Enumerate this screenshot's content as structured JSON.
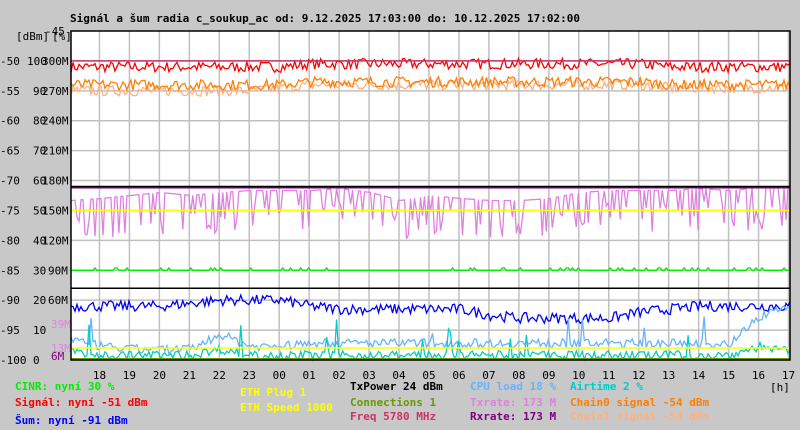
{
  "chart_data": {
    "type": "line",
    "title": "Signál a šum radia c_soukup_ac od: 9.12.2025 17:03:00 do: 10.12.2025 17:02:00",
    "unit_labels": {
      "dbm": "[dBm]",
      "pct": "[%]",
      "hours": "[h]"
    },
    "y_top_label": "-45",
    "ylim_dbm": [
      -100,
      -45
    ],
    "grid": true,
    "y_ticks": [
      {
        "dbm": "-50",
        "pct": "100",
        "rate": "300M",
        "v": -50
      },
      {
        "dbm": "-55",
        "pct": "90",
        "rate": "270M",
        "v": -55
      },
      {
        "dbm": "-60",
        "pct": "80",
        "rate": "240M",
        "v": -60
      },
      {
        "dbm": "-65",
        "pct": "70",
        "rate": "210M",
        "v": -65
      },
      {
        "dbm": "-70",
        "pct": "60",
        "rate": "180M",
        "v": -70
      },
      {
        "dbm": "-75",
        "pct": "50",
        "rate": "150M",
        "v": -75
      },
      {
        "dbm": "-80",
        "pct": "40",
        "rate": "120M",
        "v": -80
      },
      {
        "dbm": "-85",
        "pct": "30",
        "rate": "90M",
        "v": -85
      },
      {
        "dbm": "-90",
        "pct": "20",
        "rate": "60M",
        "v": -90
      },
      {
        "dbm": "-95",
        "pct": "10",
        "rate": "",
        "v": -95
      },
      {
        "dbm": "-100",
        "pct": "0",
        "rate": "",
        "v": -100
      }
    ],
    "extra_rate_labels": [
      {
        "text": "39M",
        "v": -94,
        "color": "#e080e0"
      },
      {
        "text": "13M",
        "v": -98,
        "color": "#e080e0"
      },
      {
        "text": "6M",
        "v": -99.3,
        "color": "#800080"
      }
    ],
    "x_ticks": [
      "18",
      "19",
      "20",
      "21",
      "22",
      "23",
      "00",
      "01",
      "02",
      "03",
      "04",
      "05",
      "06",
      "07",
      "08",
      "09",
      "10",
      "11",
      "12",
      "13",
      "14",
      "15",
      "16",
      "17"
    ],
    "x_range_hours": [
      0,
      24
    ],
    "series": [
      {
        "name": "Signál",
        "color": "#ff0000",
        "unit": "dBm",
        "values": [
          -51,
          -51,
          -51,
          -51,
          -51,
          -51,
          -51,
          -51,
          -50.5,
          -50.5,
          -50.5,
          -50.5,
          -50.5,
          -50.5,
          -50.5,
          -50.5,
          -50.5,
          -50.5,
          -50.5,
          -50.5,
          -51,
          -51,
          -51,
          -51,
          -51
        ]
      },
      {
        "name": "Chain1 signal",
        "color": "#ffb080",
        "unit": "dBm",
        "values": [
          -55,
          -55,
          -55,
          -55,
          -55,
          -55,
          -55,
          -54.5,
          -54,
          -54,
          -54,
          -54,
          -54,
          -54,
          -54,
          -54,
          -54,
          -54,
          -54,
          -54,
          -54.5,
          -54.5,
          -54.5,
          -54.5,
          -54.5
        ]
      },
      {
        "name": "Chain0 signal",
        "color": "#ff7f00",
        "unit": "dBm",
        "values": [
          -54,
          -54,
          -54,
          -54,
          -54,
          -54,
          -54,
          -54,
          -53.5,
          -53.5,
          -53.5,
          -53.5,
          -53.5,
          -53.5,
          -53.5,
          -53.5,
          -53.5,
          -53.5,
          -53.5,
          -53.5,
          -54,
          -54,
          -54,
          -54,
          -54
        ]
      },
      {
        "name": "Šum",
        "color": "#0000ff",
        "unit": "dBm",
        "values": [
          -91,
          -91,
          -91,
          -91,
          -90.5,
          -90,
          -90,
          -90,
          -91,
          -91.5,
          -91.5,
          -91.5,
          -91.5,
          -91.5,
          -92.5,
          -93,
          -93,
          -93,
          -93,
          -92,
          -91.5,
          -91,
          -91,
          -91,
          -91
        ]
      },
      {
        "name": "CINR",
        "color": "#00ee00",
        "unit": "%",
        "values": [
          30,
          30,
          30,
          30,
          30,
          30,
          30,
          30,
          30,
          30,
          30,
          30,
          30,
          30,
          30,
          30,
          30,
          30,
          30,
          30,
          30,
          30,
          30,
          30,
          30
        ]
      },
      {
        "name": "Txrate",
        "color": "#e080e0",
        "unit": "M",
        "values": [
          160,
          162,
          165,
          168,
          165,
          168,
          170,
          170,
          170,
          172,
          168,
          160,
          165,
          162,
          160,
          160,
          162,
          168,
          170,
          170,
          170,
          172,
          170,
          173,
          173
        ]
      },
      {
        "name": "CPU load",
        "color": "#66b3ff",
        "unit": "%",
        "values": [
          6,
          4,
          3,
          3,
          3,
          8,
          4,
          4,
          5,
          5,
          5,
          5,
          5,
          5,
          5,
          5,
          5,
          5,
          5,
          5,
          5,
          5,
          5,
          14,
          18
        ]
      },
      {
        "name": "Airtime",
        "color": "#00cccc",
        "unit": "%",
        "values": [
          2,
          1,
          1,
          1,
          1,
          3,
          1,
          1,
          1,
          1,
          1,
          1,
          1,
          1,
          1,
          1,
          1,
          1,
          1,
          1,
          1,
          1,
          1,
          4,
          2
        ]
      }
    ],
    "reference_lines": [
      {
        "name": "Freq",
        "color": "#cc3366",
        "v": -50
      },
      {
        "name": "Rxrate",
        "color": "#800080",
        "v": -71.2
      },
      {
        "name": "ETH Speed",
        "color": "#ffff00",
        "v": -75
      },
      {
        "name": "ETH Plug",
        "color": "#ffff00",
        "v": -98
      },
      {
        "name": "Connections",
        "color": "#669900",
        "v": -99.8
      }
    ],
    "separators": [
      -71,
      -88
    ]
  },
  "legend": [
    {
      "text": "CINR: nyní 30 %",
      "color": "#00ee00"
    },
    {
      "text": "Signál: nyní -51 dBm",
      "color": "#ff0000"
    },
    {
      "text": "Šum: nyní -91 dBm",
      "color": "#0000ff"
    },
    {
      "text": "ETH Plug 1",
      "color": "#ffff00"
    },
    {
      "text": "ETH Speed 1000",
      "color": "#ffff00"
    },
    {
      "text": "TxPower 24 dBm",
      "color": "#000000"
    },
    {
      "text": "Connections 1",
      "color": "#669900"
    },
    {
      "text": "Freq 5780 MHz",
      "color": "#cc3366"
    },
    {
      "text": "CPU load 18 %",
      "color": "#66b3ff"
    },
    {
      "text": "Txrate: 173 M",
      "color": "#e080e0"
    },
    {
      "text": "Rxrate: 173 M",
      "color": "#800080"
    },
    {
      "text": "Airtime 2 %",
      "color": "#00cccc"
    },
    {
      "text": "Chain0 signal -54 dBm",
      "color": "#ff7f00"
    },
    {
      "text": "Chain1 signal -54 dBm",
      "color": "#ffb080"
    }
  ]
}
